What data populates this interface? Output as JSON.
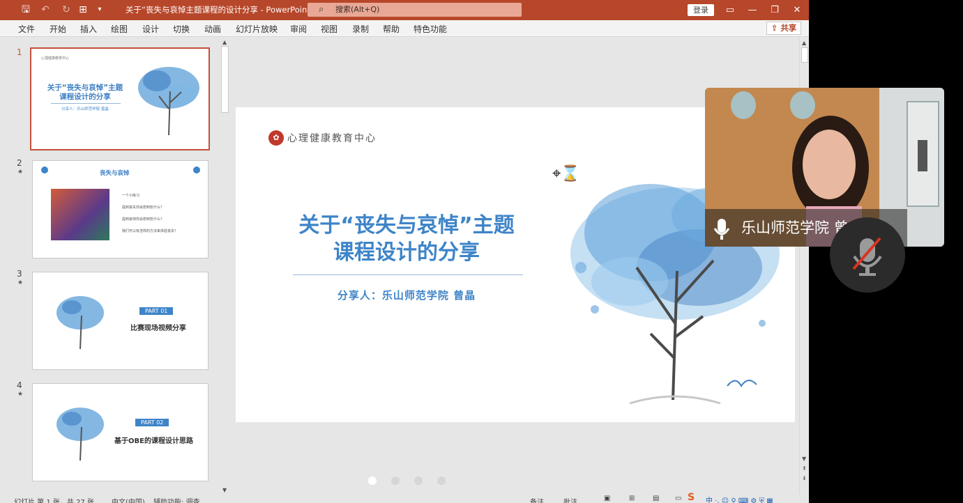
{
  "window": {
    "title": "关于“丧失与哀悼主题课程的设计分享 - PowerPoint",
    "search_placeholder": "搜索(Alt+Q)",
    "login_label": "登录"
  },
  "ribbon": {
    "tabs": [
      "文件",
      "开始",
      "插入",
      "绘图",
      "设计",
      "切换",
      "动画",
      "幻灯片放映",
      "审阅",
      "视图",
      "录制",
      "帮助",
      "特色功能"
    ],
    "share_label": "共享"
  },
  "thumbnails": [
    {
      "number": "1",
      "title_line1": "关于“丧失与哀悼”主题",
      "title_line2": "课程设计的分享",
      "subtitle": "分享人：乐山师范学院 曾晶",
      "logo_text": "心理健康教育中心"
    },
    {
      "number": "2",
      "title": "丧失与哀悼",
      "lines": [
        "一个小练习",
        "提到丧失你会想到些什么？",
        "提到哀悼你会想到些什么？",
        "我们可以有怎样的方法来体验丧失？"
      ]
    },
    {
      "number": "3",
      "part": "PART 01",
      "subtitle": "比赛现场视频分享"
    },
    {
      "number": "4",
      "part": "PART 02",
      "subtitle": "基于OBE的课程设计思路"
    }
  ],
  "slide": {
    "logo_text": "心理健康教育中心",
    "title_line1": "关于“丧失与哀悼”主题",
    "title_line2": "课程设计的分享",
    "presenter": "分享人：乐山师范学院  曾晶"
  },
  "status": {
    "slide_info": "幻灯片 第 1 张，共 27 张",
    "language": "中文(中国)",
    "accessibility": "辅助功能: 调查",
    "notes_label": "备注",
    "comments_label": "批注"
  },
  "video": {
    "participant_name": "乐山师范学院 曾晶"
  },
  "colors": {
    "titlebar": "#b7472a",
    "accent": "#3e84c8",
    "selected_border": "#c4503a"
  }
}
